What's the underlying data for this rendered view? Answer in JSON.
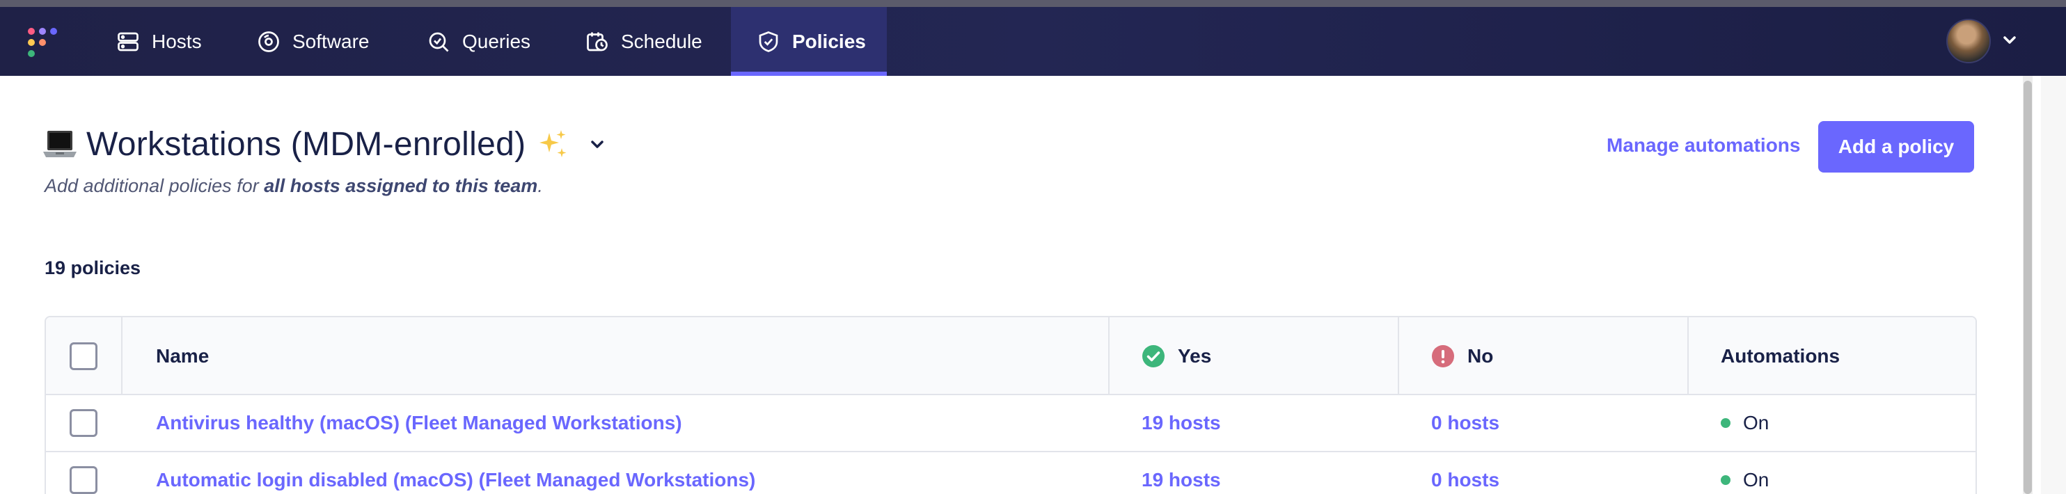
{
  "nav": {
    "items": [
      {
        "label": "Hosts",
        "icon": "hosts-icon"
      },
      {
        "label": "Software",
        "icon": "software-icon"
      },
      {
        "label": "Queries",
        "icon": "queries-icon"
      },
      {
        "label": "Schedule",
        "icon": "schedule-icon"
      },
      {
        "label": "Policies",
        "icon": "policies-icon",
        "active": true
      }
    ]
  },
  "team": {
    "name": "Workstations (MDM-enrolled)",
    "subtitle_prefix": "Add additional policies for ",
    "subtitle_bold": "all hosts assigned to this team",
    "subtitle_suffix": "."
  },
  "actions": {
    "manage_automations": "Manage automations",
    "add_policy": "Add a policy"
  },
  "policy_count": "19 policies",
  "table": {
    "headers": {
      "name": "Name",
      "yes": "Yes",
      "no": "No",
      "automations": "Automations"
    },
    "rows": [
      {
        "name": "Antivirus healthy (macOS) (Fleet Managed Workstations)",
        "yes": "19 hosts",
        "no": "0 hosts",
        "automations": "On"
      },
      {
        "name": "Automatic login disabled (macOS) (Fleet Managed Workstations)",
        "yes": "19 hosts",
        "no": "0 hosts",
        "automations": "On"
      }
    ]
  },
  "colors": {
    "accent": "#6a67fe",
    "nav_background": "#1f2147",
    "yes_status": "#3db67b",
    "no_status": "#d66c7b",
    "automation_on": "#3db67b"
  }
}
